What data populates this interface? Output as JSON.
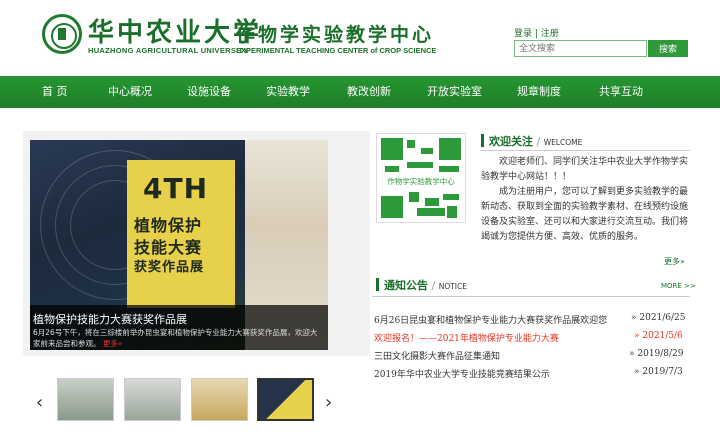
{
  "header": {
    "univ_cn": "华中农业大学",
    "univ_en": "HUAZHONG AGRICULTURAL UNIVERSITY",
    "center_cn": "作物学实验教学中心",
    "center_en": "EXPERIMENTAL TEACHING CENTER of CROP SCIENCE",
    "login": "登录",
    "sep": " | ",
    "register": "注册",
    "search_placeholder": "全文搜索",
    "search_button": "搜索"
  },
  "nav": [
    {
      "label": "首  页"
    },
    {
      "label": "中心概况"
    },
    {
      "label": "设施设备"
    },
    {
      "label": "实验教学"
    },
    {
      "label": "教改创新"
    },
    {
      "label": "开放实验室"
    },
    {
      "label": "规章制度"
    },
    {
      "label": "共享互动"
    }
  ],
  "slider": {
    "title": "植物保护技能力大赛获奖作品展",
    "desc": "6月26号下午，将在三综楼前举办昆虫宴和植物保护专业能力大赛获奖作品展，欢迎大家前来品尝和参观。",
    "more": "更多»",
    "poster_4th": "4TH",
    "poster_line1": "植物保护",
    "poster_line2": "技能大赛",
    "poster_line3": "获奖作品展",
    "prev": "‹",
    "next": "›"
  },
  "welcome": {
    "title": "欢迎关注",
    "sep": " / ",
    "title_en": "WELCOME",
    "qr_label": "作物学实验教学中心",
    "para1": "欢迎老师们、同学们关注华中农业大学作物学实验教学中心网站！！！",
    "para2": "成为注册用户，您可以了解到更多实验教学的最新动态、获取到全面的实验教学素材、在线预约设施设备及实验室、还可以和大家进行交流互动。我们将竭诚为您提供方便、高效、优质的服务。",
    "more": "更多»"
  },
  "notice": {
    "title": "通知公告",
    "sep": " / ",
    "title_en": "NOTICE",
    "more": "MORE >>",
    "items": [
      {
        "text": "6月26日昆虫宴和植物保护专业能力大赛获奖作品展欢迎您",
        "date": "» 2021/6/25"
      },
      {
        "text": "欢迎报名！——2021年植物保护专业能力大赛",
        "date": "» 2021/5/6"
      },
      {
        "text": "三田文化摄影大赛作品征集通知",
        "date": "» 2019/8/29"
      },
      {
        "text": "2019年华中农业大学专业技能竞赛结果公示",
        "date": "» 2019/7/3"
      }
    ]
  },
  "colors": {
    "brand_green": "#1a6f2a",
    "nav_green": "#279632",
    "highlight_red": "#e63320"
  }
}
